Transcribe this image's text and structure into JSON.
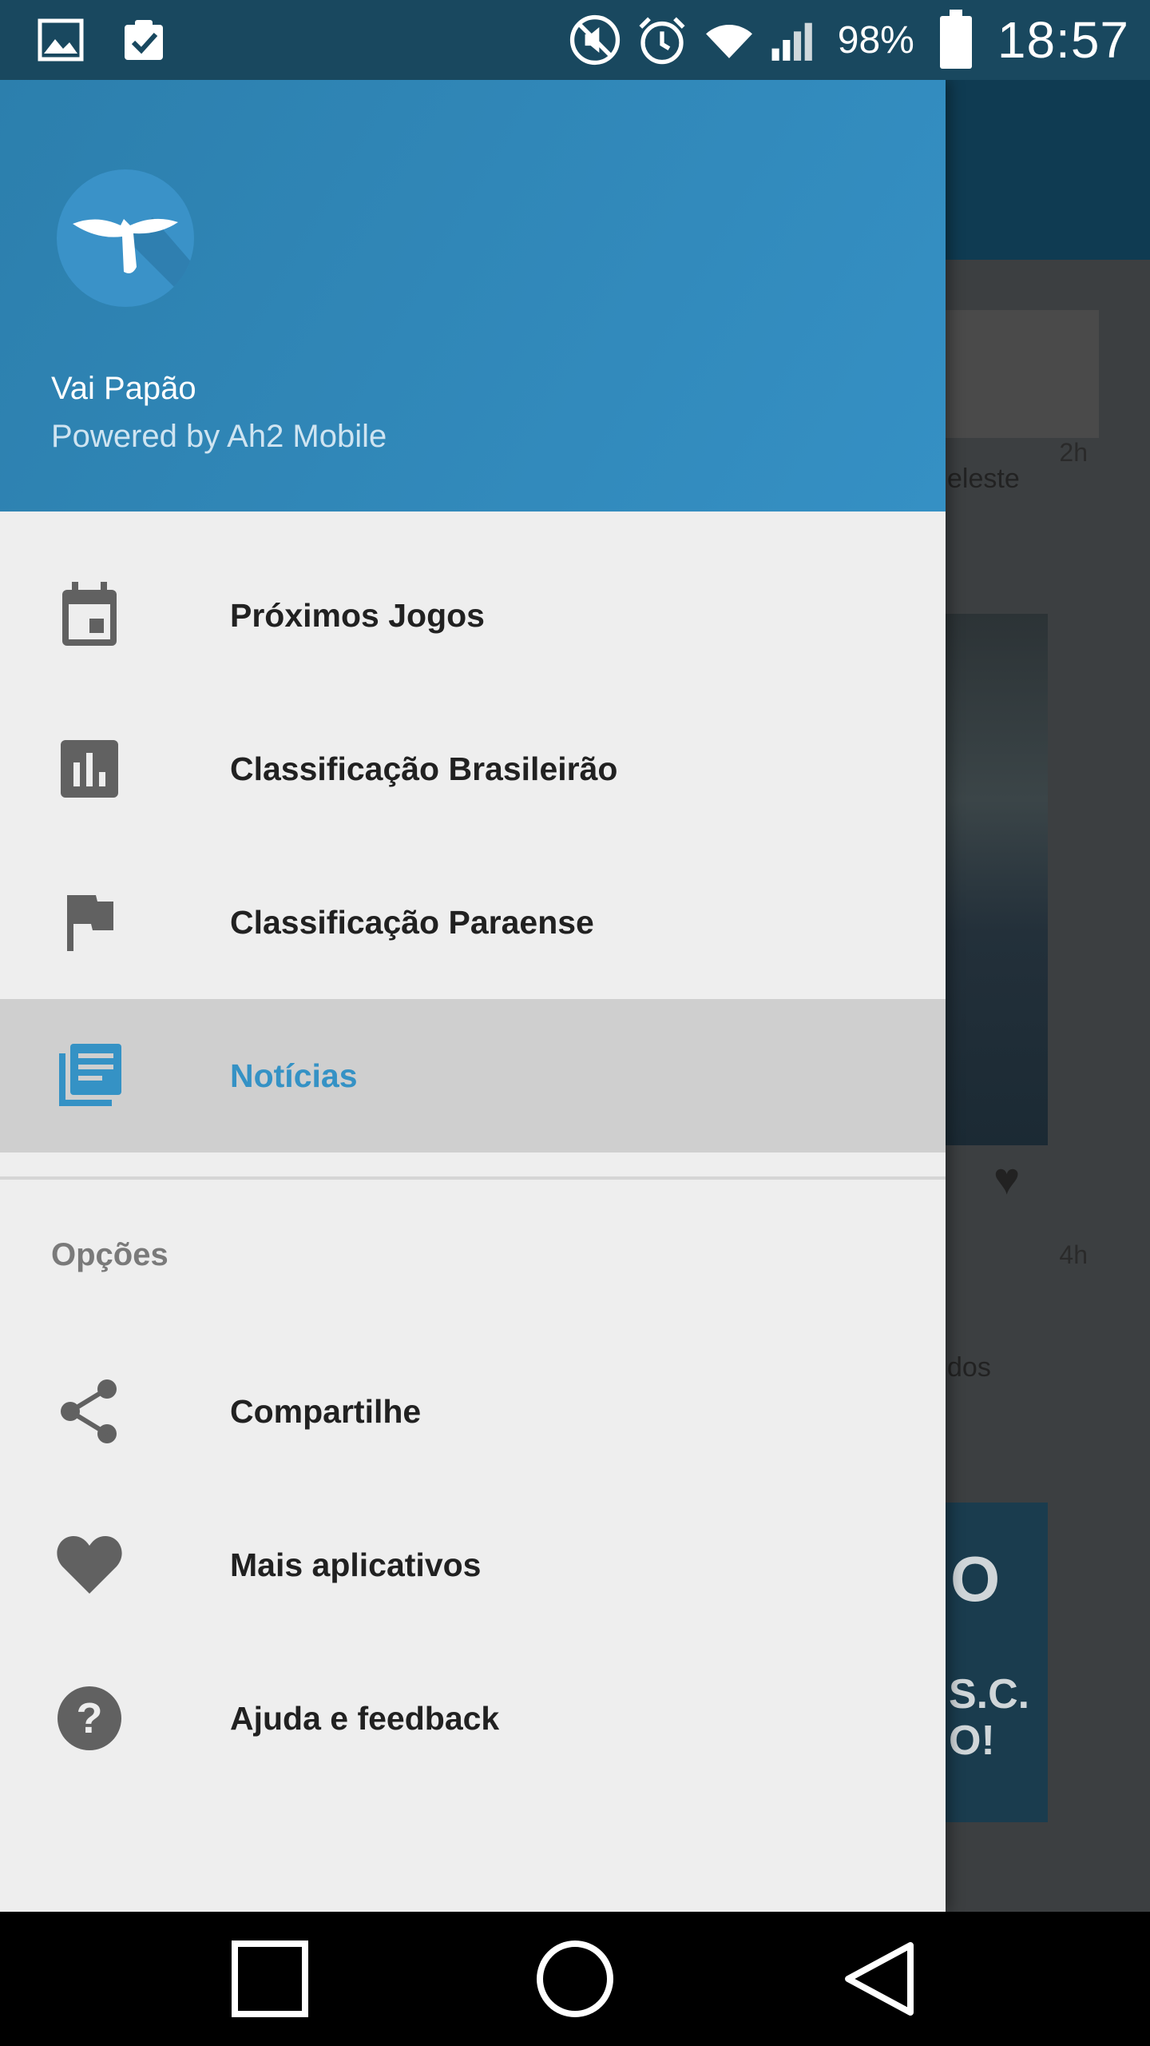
{
  "status_bar": {
    "battery_percent": "98%",
    "time": "18:57",
    "icons": [
      "image-icon",
      "clipboard-check-icon",
      "mute-icon",
      "alarm-icon",
      "wifi-icon",
      "signal-icon",
      "battery-icon"
    ]
  },
  "background_feed": {
    "cards": [
      {
        "time": "2h",
        "snippet": "eleste"
      },
      {
        "time": "4h",
        "snippet": "dos"
      }
    ],
    "image2_text": [
      "O",
      "S.C.",
      "O!"
    ]
  },
  "drawer": {
    "header": {
      "title": "Vai Papão",
      "subtitle": "Powered by Ah2 Mobile",
      "background_color": "#3590c4"
    },
    "menu": [
      {
        "label": "Próximos Jogos",
        "icon": "calendar-icon"
      },
      {
        "label": "Classificação Brasileirão",
        "icon": "bar-chart-icon"
      },
      {
        "label": "Classificação Paraense",
        "icon": "flag-icon"
      },
      {
        "label": "Notícias",
        "icon": "news-icon",
        "active": true
      }
    ],
    "options_section": {
      "title": "Opções",
      "items": [
        {
          "label": "Compartilhe",
          "icon": "share-icon"
        },
        {
          "label": "Mais aplicativos",
          "icon": "heart-icon"
        },
        {
          "label": "Ajuda e feedback",
          "icon": "help-icon"
        }
      ]
    },
    "accent_color": "#3592c5"
  },
  "nav_bar": {
    "buttons": [
      "recent-apps",
      "home",
      "back"
    ]
  }
}
